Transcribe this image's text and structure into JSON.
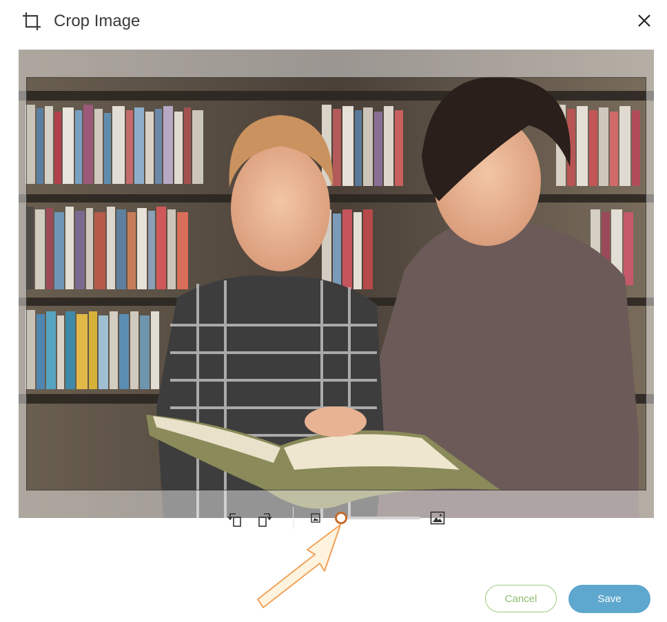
{
  "dialog": {
    "title": "Crop Image",
    "icons": {
      "crop": "crop-icon",
      "close": "close-icon"
    }
  },
  "toolbar": {
    "icons": {
      "rotate_left": "rotate-left-icon",
      "rotate_right": "rotate-right-icon",
      "zoom_out": "image-small-icon",
      "zoom_in": "image-large-icon"
    },
    "zoom": {
      "level": 0.06
    }
  },
  "footer": {
    "cancel_label": "Cancel",
    "save_label": "Save"
  },
  "colors": {
    "accent_save": "#5ea7ce",
    "accent_cancel": "#8fbd6f",
    "slider_knob": "#c56a2a",
    "annotation_arrow": "#f0a25a"
  }
}
